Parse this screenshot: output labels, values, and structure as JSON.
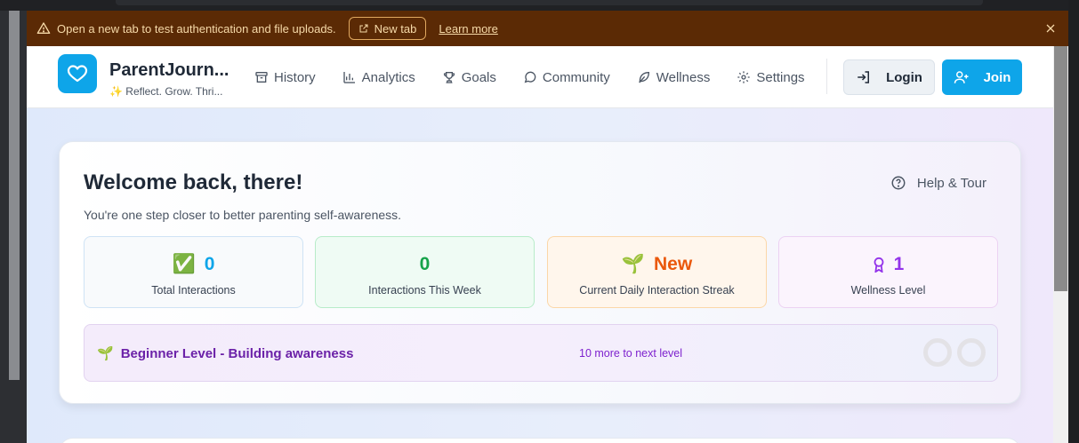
{
  "banner": {
    "message": "Open a new tab to test authentication and file uploads.",
    "new_tab_label": "New tab",
    "learn_more_label": "Learn more",
    "icon": "warning-icon",
    "background": "#5b2a05"
  },
  "header": {
    "brand_name": "ParentJourn...",
    "tagline_emoji": "✨",
    "tagline": "Reflect. Grow. Thri...",
    "logo_icon": "heart-icon",
    "accent": "#0ea5e9"
  },
  "nav": {
    "items": [
      {
        "label": "History",
        "icon": "archive-icon"
      },
      {
        "label": "Analytics",
        "icon": "bar-chart-icon"
      },
      {
        "label": "Goals",
        "icon": "trophy-icon"
      },
      {
        "label": "Community",
        "icon": "chat-bubble-icon"
      },
      {
        "label": "Wellness",
        "icon": "leaf-icon"
      },
      {
        "label": "Settings",
        "icon": "gear-icon"
      }
    ],
    "login_label": "Login",
    "join_label": "Join"
  },
  "dashboard": {
    "welcome": "Welcome back, there!",
    "subtitle": "You're one step closer to better parenting self-awareness.",
    "help_label": "Help & Tour",
    "stats": [
      {
        "emoji": "✅",
        "value": "0",
        "label": "Total Interactions",
        "color": "#0ea5e9"
      },
      {
        "emoji": "",
        "value": "0",
        "label": "Interactions This Week",
        "color": "#16a34a"
      },
      {
        "emoji": "🌱",
        "value": "New",
        "label": "Current Daily Interaction Streak",
        "color": "#ea580c"
      },
      {
        "emoji": "",
        "value": "1",
        "label": "Wellness Level",
        "color": "#9333ea"
      }
    ],
    "level": {
      "emoji": "🌱",
      "name": "Beginner Level - Building awareness",
      "next": "10 more to next level"
    }
  }
}
